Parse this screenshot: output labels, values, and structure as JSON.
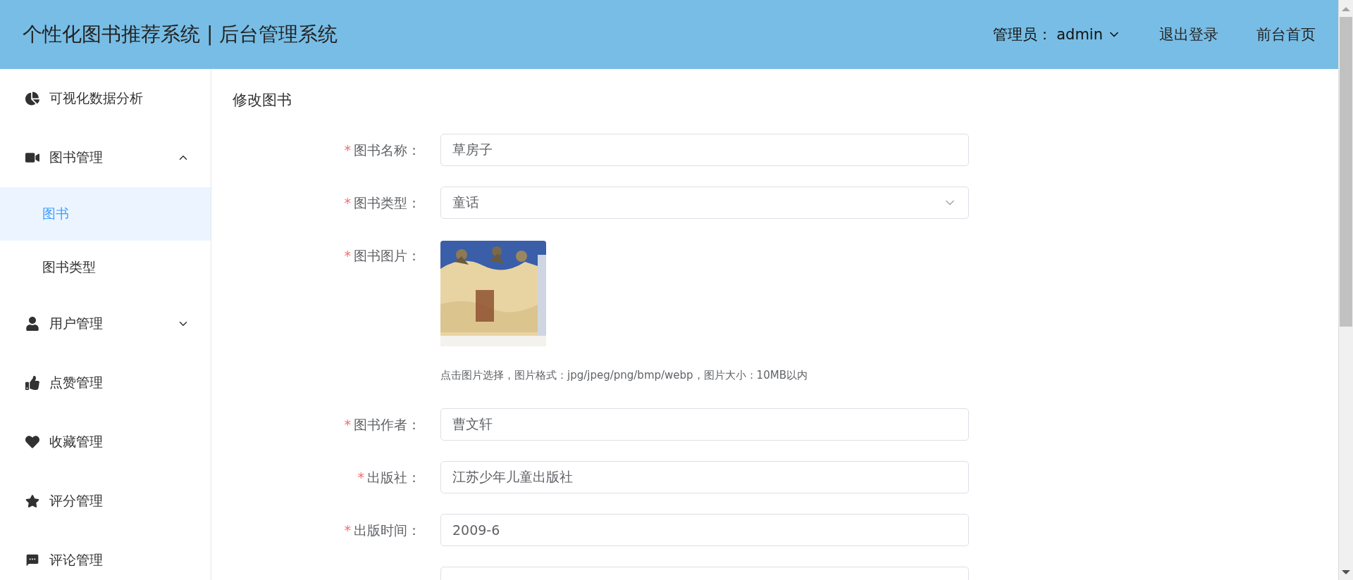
{
  "header": {
    "title": "个性化图书推荐系统 | 后台管理系统",
    "admin_label": "管理员：",
    "admin_name": "admin",
    "links": [
      "退出登录",
      "前台首页"
    ]
  },
  "sidebar": {
    "items": [
      {
        "label": "可视化数据分析",
        "kind": "item",
        "selected": false
      },
      {
        "label": "图书管理",
        "kind": "group",
        "expanded": true,
        "selected": false,
        "children": [
          {
            "label": "图书",
            "selected": true
          },
          {
            "label": "图书类型",
            "selected": false
          }
        ]
      },
      {
        "label": "用户管理",
        "kind": "group",
        "expanded": false,
        "selected": false
      },
      {
        "label": "点赞管理",
        "kind": "item",
        "selected": false
      },
      {
        "label": "收藏管理",
        "kind": "item",
        "selected": false
      },
      {
        "label": "评分管理",
        "kind": "item",
        "selected": false
      },
      {
        "label": "评论管理",
        "kind": "item",
        "selected": false
      }
    ]
  },
  "form": {
    "title": "修改图书",
    "fields": [
      {
        "kind": "input",
        "label": "图书名称：",
        "required_mark": "*",
        "value": "草房子"
      },
      {
        "kind": "select",
        "label": "图书类型：",
        "required_mark": "*",
        "value": "童话"
      },
      {
        "label": "图书图片：",
        "required_mark": "*",
        "hint": "点击图片选择，图片格式：jpg/jpeg/png/bmp/webp，图片大小：10MB以内"
      },
      {
        "kind": "input",
        "label": "图书作者：",
        "required_mark": "*",
        "value": "曹文轩"
      },
      {
        "kind": "input",
        "label": "出版社：",
        "required_mark": "*",
        "value": "江苏少年儿童出版社"
      },
      {
        "kind": "input",
        "label": "出版时间：",
        "required_mark": "*",
        "value": "2009-6"
      },
      {
        "kind": "input"
      }
    ]
  }
}
